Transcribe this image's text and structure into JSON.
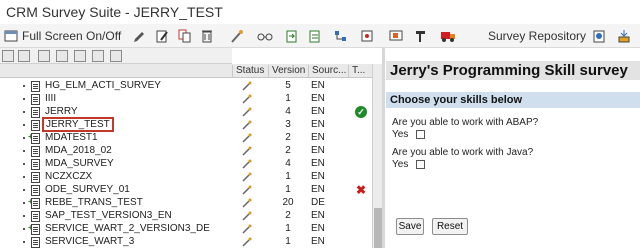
{
  "window": {
    "title": "CRM Survey Suite - JERRY_TEST"
  },
  "toolbar": {
    "fullscreen_label": "Full Screen On/Off",
    "repository_label": "Survey Repository",
    "icons": [
      "fullscreen-toggle-icon",
      "pencil-icon",
      "copy-icon",
      "trash-icon",
      "wand-icon",
      "glasses-icon",
      "export-icon",
      "import-icon",
      "tree-icon",
      "pin-icon",
      "screen-icon",
      "stack-icon",
      "truck-icon",
      "repository-icon",
      "download-icon"
    ]
  },
  "columns": {
    "status": "Status",
    "version": "Version",
    "source": "Sourc...",
    "type": "T..."
  },
  "rows": [
    {
      "name": "HG_ELM_ACTI_SURVEY",
      "version": "5",
      "source": "EN",
      "plus": false,
      "mark": ""
    },
    {
      "name": "IIII",
      "version": "1",
      "source": "EN",
      "plus": false,
      "mark": ""
    },
    {
      "name": "JERRY",
      "version": "4",
      "source": "EN",
      "plus": false,
      "mark": "ok"
    },
    {
      "name": "JERRY_TEST",
      "version": "3",
      "source": "EN",
      "plus": false,
      "mark": "",
      "selected": true
    },
    {
      "name": "MDATEST1",
      "version": "2",
      "source": "EN",
      "plus": true,
      "mark": ""
    },
    {
      "name": "MDA_2018_02",
      "version": "2",
      "source": "EN",
      "plus": false,
      "mark": ""
    },
    {
      "name": "MDA_SURVEY",
      "version": "4",
      "source": "EN",
      "plus": false,
      "mark": ""
    },
    {
      "name": "NCZXCZX",
      "version": "1",
      "source": "EN",
      "plus": false,
      "mark": ""
    },
    {
      "name": "ODE_SURVEY_01",
      "version": "1",
      "source": "EN",
      "plus": false,
      "mark": "err"
    },
    {
      "name": "REBE_TRANS_TEST",
      "version": "20",
      "source": "DE",
      "plus": true,
      "mark": ""
    },
    {
      "name": "SAP_TEST_VERSION3_EN",
      "version": "2",
      "source": "EN",
      "plus": false,
      "mark": ""
    },
    {
      "name": "SERVICE_WART_2_VERSION3_DE",
      "version": "1",
      "source": "EN",
      "plus": true,
      "mark": ""
    },
    {
      "name": "SERVICE_WART_3",
      "version": "1",
      "source": "EN",
      "plus": false,
      "mark": ""
    }
  ],
  "marks": {
    "ok": "✓",
    "err": "✖"
  },
  "survey": {
    "title": "Jerry's Programming Skill survey",
    "section": "Choose your skills below",
    "q1": "Are you able to work with ABAP?",
    "q2": "Are you able to work with Java?",
    "yes_label": "Yes",
    "save_label": "Save",
    "reset_label": "Reset"
  },
  "colors": {
    "ok": "#1f8a2a",
    "err": "#c81e1e",
    "selected_border": "#c0392b",
    "section_bg": "#cfdfee"
  }
}
